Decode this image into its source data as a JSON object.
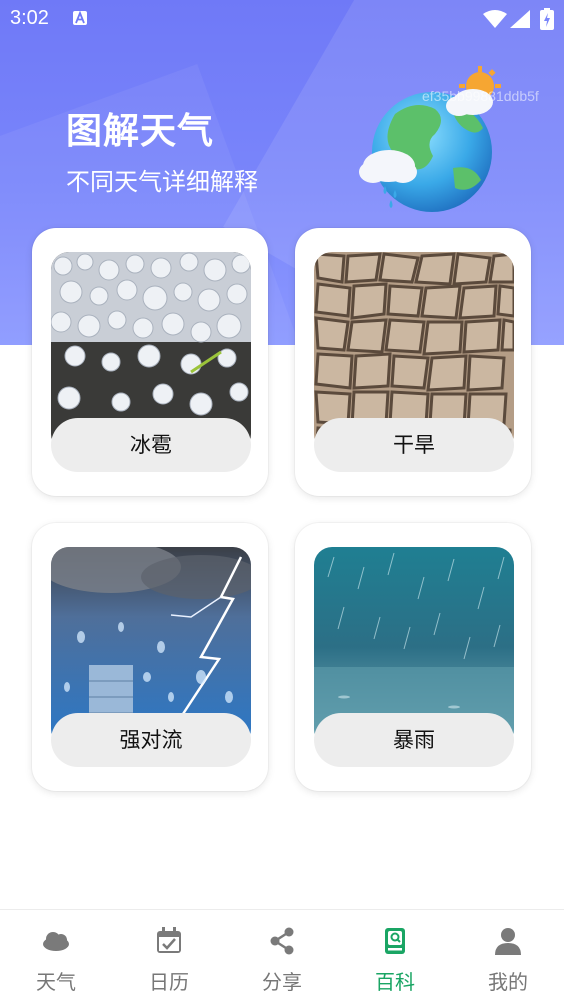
{
  "status_bar": {
    "time": "3:02"
  },
  "hero": {
    "title": "图解天气",
    "subtitle": "不同天气详细解释",
    "id_text": "ef35bb99881ddb5f"
  },
  "cards": [
    {
      "label": "冰雹",
      "image": "hail-photo"
    },
    {
      "label": "干旱",
      "image": "drought-cracked-earth-photo"
    },
    {
      "label": "强对流",
      "image": "storm-lightning-photo"
    },
    {
      "label": "暴雨",
      "image": "heavy-rain-photo"
    }
  ],
  "tabbar": {
    "active": "百科",
    "active_color": "#1aa564",
    "items": [
      {
        "label": "天气",
        "icon": "cloud-icon"
      },
      {
        "label": "日历",
        "icon": "calendar-icon"
      },
      {
        "label": "分享",
        "icon": "share-icon"
      },
      {
        "label": "百科",
        "icon": "book-icon"
      },
      {
        "label": "我的",
        "icon": "user-icon"
      }
    ]
  }
}
